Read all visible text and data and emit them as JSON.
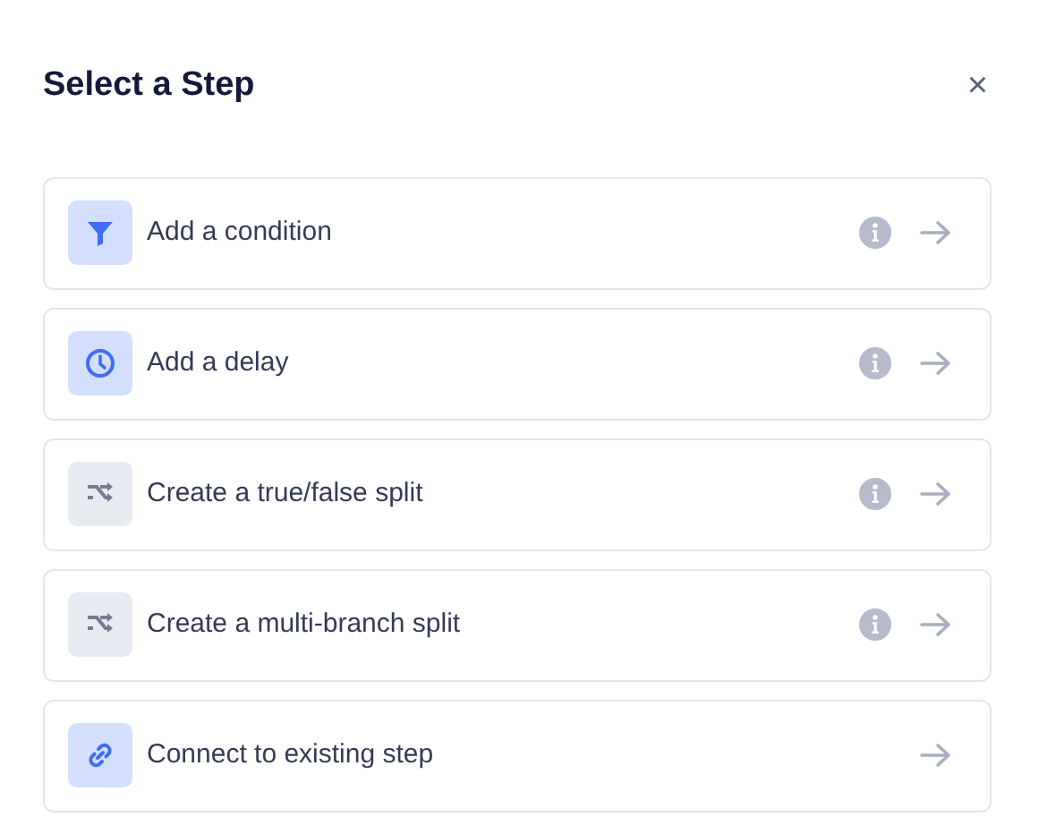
{
  "title": "Select a Step",
  "close": "×",
  "steps": [
    {
      "kind": "filter",
      "label": "Add a condition",
      "info": true
    },
    {
      "kind": "clock",
      "label": "Add a delay",
      "info": true
    },
    {
      "kind": "split",
      "label": "Create a true/false split",
      "info": true
    },
    {
      "kind": "split",
      "label": "Create a multi-branch split",
      "info": true
    },
    {
      "kind": "link",
      "label": "Connect to existing step",
      "info": false
    }
  ]
}
